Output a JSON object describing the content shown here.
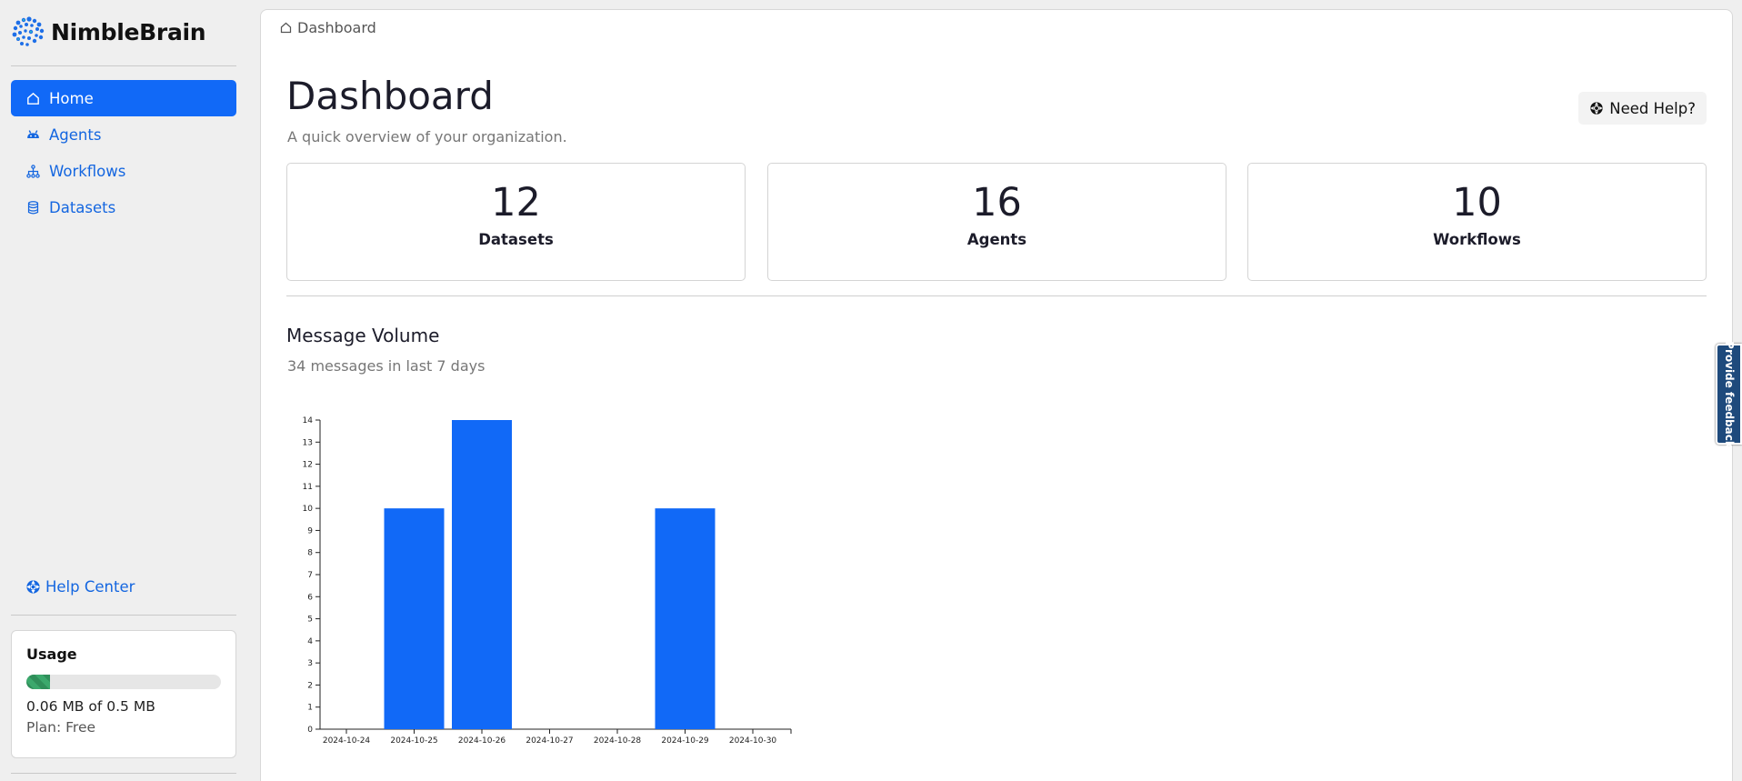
{
  "app": {
    "brand_name": "NimbleBrain",
    "accent_color": "#1169f7"
  },
  "sidebar": {
    "items": [
      {
        "label": "Home",
        "icon": "home-icon",
        "active": true
      },
      {
        "label": "Agents",
        "icon": "robot-icon",
        "active": false
      },
      {
        "label": "Workflows",
        "icon": "workflow-icon",
        "active": false
      },
      {
        "label": "Datasets",
        "icon": "database-icon",
        "active": false
      }
    ],
    "help_center": "Help Center",
    "usage": {
      "title": "Usage",
      "used_fraction": 0.12,
      "text": "0.06 MB of 0.5 MB",
      "plan": "Plan: Free"
    }
  },
  "breadcrumb": {
    "label": "Dashboard"
  },
  "header": {
    "title": "Dashboard",
    "subtitle": "A quick overview of your organization.",
    "help_button": "Need Help?"
  },
  "stats": [
    {
      "value": "12",
      "label": "Datasets"
    },
    {
      "value": "16",
      "label": "Agents"
    },
    {
      "value": "10",
      "label": "Workflows"
    }
  ],
  "message_volume": {
    "title": "Message Volume",
    "subtitle": "34 messages in last 7 days"
  },
  "chart_data": {
    "type": "bar",
    "categories": [
      "2024-10-24",
      "2024-10-25",
      "2024-10-26",
      "2024-10-27",
      "2024-10-28",
      "2024-10-29",
      "2024-10-30"
    ],
    "values": [
      0,
      10,
      14,
      0,
      0,
      10,
      0
    ],
    "ylim": [
      0,
      14
    ],
    "yticks": [
      0,
      1,
      2,
      3,
      4,
      5,
      6,
      7,
      8,
      9,
      10,
      11,
      12,
      13,
      14
    ],
    "color": "#1169f7",
    "grid": false
  },
  "feedback_tab": "Provide feedback"
}
